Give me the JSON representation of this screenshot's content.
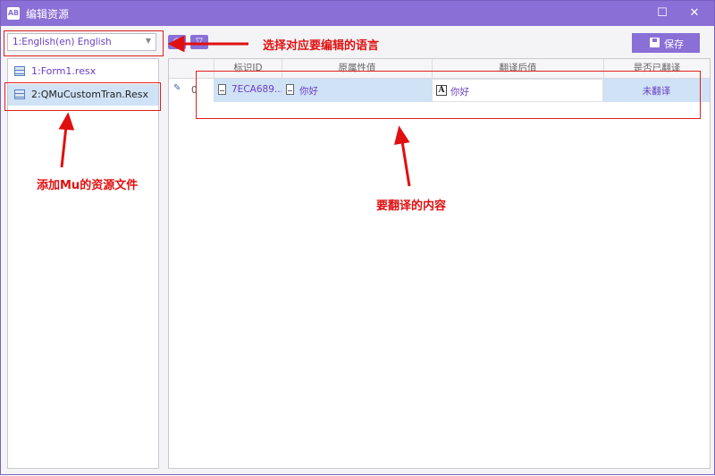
{
  "window": {
    "app_icon_text": "AB",
    "title": "编辑资源"
  },
  "controls": {
    "minimize": "—",
    "maximize": "☐",
    "close": "✕"
  },
  "toolbar": {
    "language_value": "1:English(en) English",
    "save_label": "保存",
    "eraser_icon": "eraser-icon",
    "filter_icon": "filter-icon"
  },
  "files": [
    {
      "label": "1:Form1.resx"
    },
    {
      "label": "2:QMuCustomTran.Resx"
    }
  ],
  "grid": {
    "columns": [
      "标识ID",
      "原属性值",
      "翻译后值",
      "是否已翻译"
    ],
    "rows": [
      {
        "index": "0",
        "id": "7ECA689...",
        "original": "你好",
        "translated": "你好",
        "status": "未翻译"
      }
    ]
  },
  "annotations": {
    "select_language": "选择对应要编辑的语言",
    "add_mu_resources": "添加Mu的资源文件",
    "content_to_translate": "要翻译的内容"
  },
  "colors": {
    "title_bar": "#8a6fd6",
    "accent_text": "#6a3fc6",
    "selection": "#cfe2f6",
    "annotation_red": "#e01010"
  }
}
